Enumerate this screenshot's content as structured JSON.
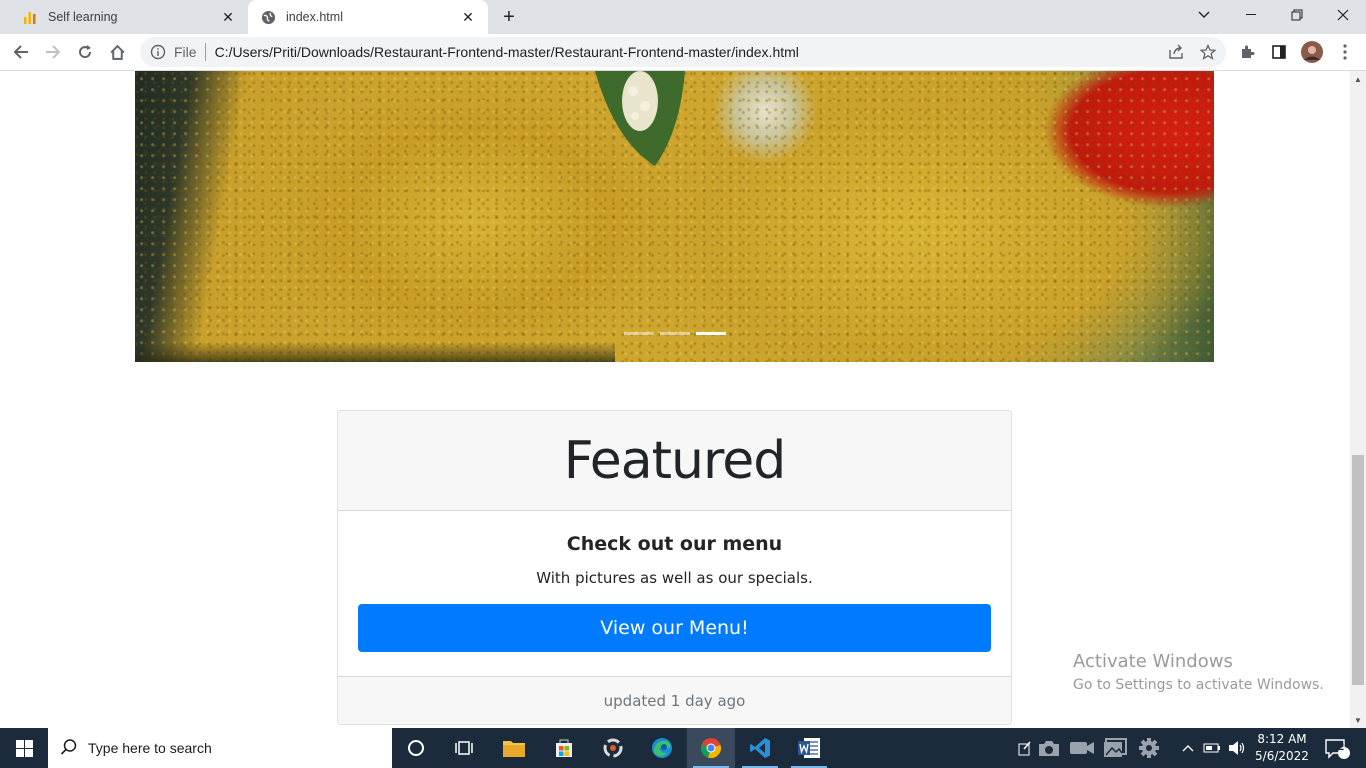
{
  "browser": {
    "tabs": [
      {
        "title": "Self learning",
        "active": false,
        "favicon": "bar-chart-icon"
      },
      {
        "title": "index.html",
        "active": true,
        "favicon": "globe-icon"
      }
    ],
    "file_label": "File",
    "url": "C:/Users/Priti/Downloads/Restaurant-Frontend-master/Restaurant-Frontend-master/index.html"
  },
  "page": {
    "carousel": {
      "slides": 3,
      "active_slide": 3,
      "image": "food-dish-photo"
    },
    "card": {
      "header": "Featured",
      "title": "Check out our menu",
      "text": "With pictures as well as our specials.",
      "button_label": "View our Menu!",
      "footer": "updated 1 day ago"
    }
  },
  "watermark": {
    "line1": "Activate Windows",
    "line2": "Go to Settings to activate Windows."
  },
  "taskbar": {
    "search_placeholder": "Type here to search",
    "time": "8:12 AM",
    "date": "5/6/2022",
    "notification_count": "2"
  },
  "colors": {
    "primary": "#007bff",
    "taskbar": "#1c2b3c"
  }
}
